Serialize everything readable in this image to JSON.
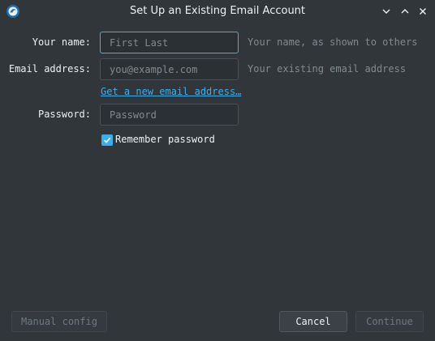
{
  "window": {
    "title": "Set Up an Existing Email Account",
    "app_icon": "thunderbird-icon",
    "controls": [
      "minimize-icon",
      "maximize-icon",
      "close-icon"
    ]
  },
  "form": {
    "name": {
      "label": "Your name:",
      "placeholder": "First Last",
      "value": "",
      "hint": "Your name, as shown to others"
    },
    "email": {
      "label": "Email address:",
      "placeholder": "you@example.com",
      "value": "",
      "hint": "Your existing email address"
    },
    "new_email_link": "Get a new email address…",
    "password": {
      "label": "Password:",
      "placeholder": "Password",
      "value": ""
    },
    "remember": {
      "label": "Remember password",
      "checked": true
    }
  },
  "buttons": {
    "manual_config": "Manual config",
    "cancel": "Cancel",
    "continue": "Continue"
  },
  "colors": {
    "background": "#31363b",
    "accent": "#3daee9",
    "text": "#eff0f1",
    "muted_text": "#7f8c8d"
  }
}
